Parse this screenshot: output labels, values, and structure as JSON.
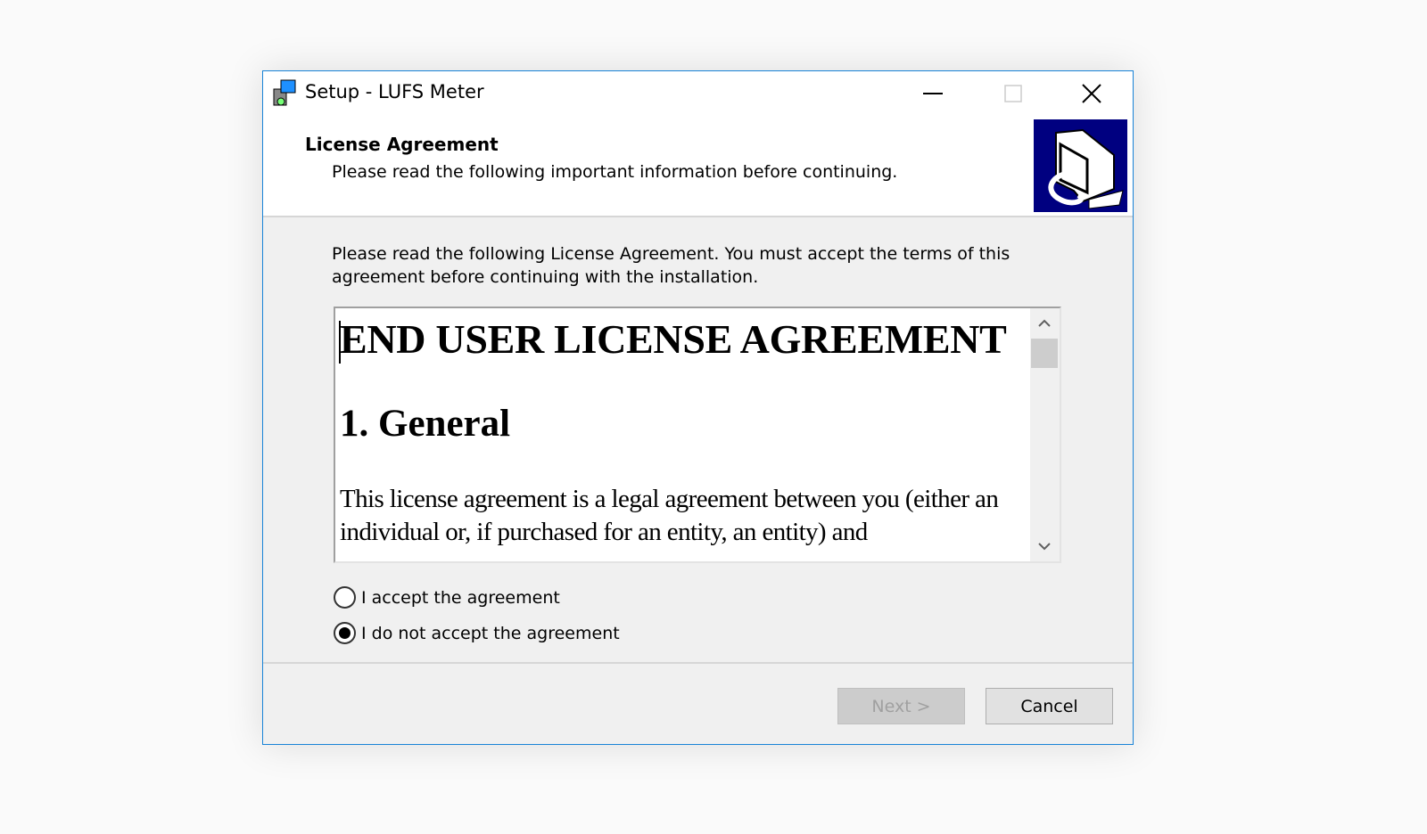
{
  "window": {
    "title": "Setup - LUFS Meter",
    "minimize_icon": "minimize-icon",
    "maximize_icon": "maximize-icon",
    "close_icon": "close-icon"
  },
  "header": {
    "title": "License Agreement",
    "subtitle": "Please read the following important information before continuing."
  },
  "intro": "Please read the following License Agreement. You must accept the terms of this agreement before continuing with the installation.",
  "license": {
    "heading": "END USER LICENSE AGREEMENT",
    "section": "1. General",
    "paragraph": "This license agreement is a legal agreement between you (either an individual or, if purchased for an entity, an entity) and"
  },
  "options": [
    {
      "label": "I accept the agreement",
      "selected": false
    },
    {
      "label": "I do not accept the agreement",
      "selected": true
    }
  ],
  "buttons": {
    "next": "Next >",
    "next_enabled": false,
    "cancel": "Cancel"
  },
  "colors": {
    "accent": "#1883d7",
    "header_image": "#000080"
  }
}
